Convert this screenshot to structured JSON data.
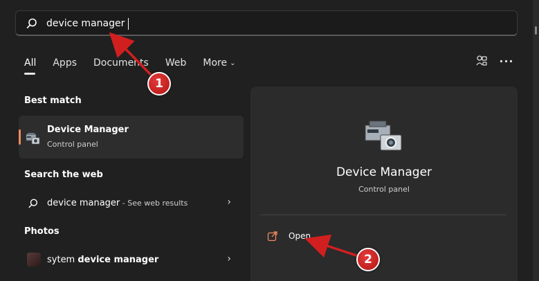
{
  "search": {
    "value": "device manager",
    "placeholder": ""
  },
  "tabs": [
    {
      "label": "All"
    },
    {
      "label": "Apps"
    },
    {
      "label": "Documents"
    },
    {
      "label": "Web"
    },
    {
      "label": "More"
    }
  ],
  "sections": {
    "best_match": "Best match",
    "search_web": "Search the web",
    "photos": "Photos"
  },
  "best_match_item": {
    "title": "Device Manager",
    "subtitle": "Control panel"
  },
  "web_result": {
    "query": "device manager",
    "suffix": " - See web results"
  },
  "photo_result": {
    "prefix": "sytem ",
    "highlight": "device manager"
  },
  "right_panel": {
    "title": "Device Manager",
    "subtitle": "Control panel",
    "open_label": "Open"
  },
  "annotations": {
    "badge1": "1",
    "badge2": "2"
  },
  "colors": {
    "accent": "#f08a5d",
    "annotation_red": "#d11f1f",
    "background": "#202020",
    "card": "#2d2d2d"
  },
  "icons": {
    "search": "search-icon",
    "device_manager": "device-manager-icon",
    "open": "open-external-icon",
    "chevron": "chevron-right-icon",
    "share": "share-icon",
    "more": "more-options-icon"
  }
}
